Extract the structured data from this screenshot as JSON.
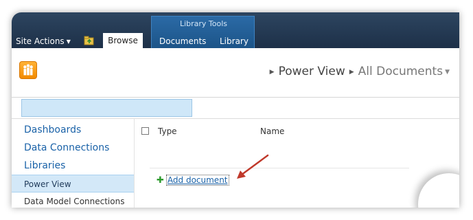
{
  "ribbon": {
    "site_actions": "Site Actions",
    "context_group": "Library Tools",
    "tabs": [
      "Browse",
      "Documents",
      "Library"
    ]
  },
  "breadcrumb": {
    "current": "Power View",
    "view": "All Documents"
  },
  "quicklaunch": {
    "items": [
      "Dashboards",
      "Data Connections",
      "Libraries",
      "Power View",
      "Data Model Connections"
    ]
  },
  "list": {
    "columns": [
      "Type",
      "Name"
    ],
    "add_document": "Add document"
  },
  "colors": {
    "ribbon": "#22374e",
    "context_tab": "#1c5488",
    "link": "#1a62a8",
    "selected_nav": "#d3e8f8",
    "arrow": "#c0392b",
    "logo": "#f28a00"
  }
}
